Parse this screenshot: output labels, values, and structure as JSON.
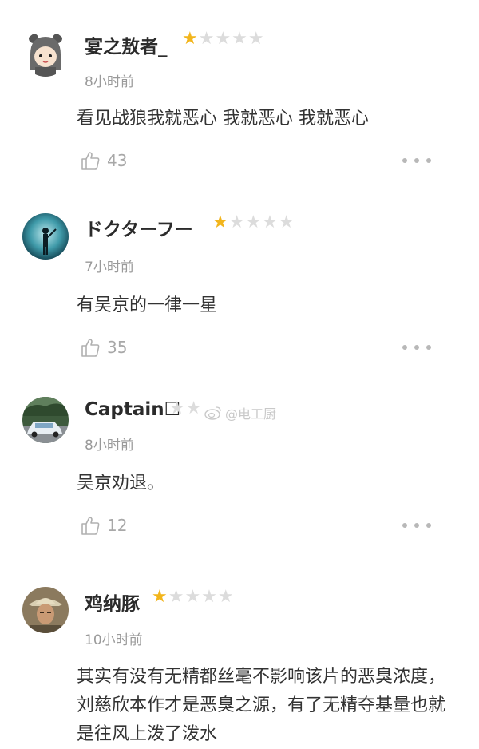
{
  "colors": {
    "star_on": "#f2b51c",
    "star_off": "#dcdcdc",
    "meta": "#9a9a9a",
    "text": "#333333"
  },
  "reviews": [
    {
      "username": "宴之敖者_",
      "rating": 1,
      "max_rating": 5,
      "time": "8小时前",
      "content": "看见战狼我就恶心 我就恶心 我就恶心",
      "likes": "43",
      "avatar_icon": "cartoon-bear-hood-avatar"
    },
    {
      "username": "ドクターフー",
      "rating": 1,
      "max_rating": 5,
      "time": "7小时前",
      "content": "有吴京的一律一星",
      "likes": "35",
      "avatar_icon": "silhouette-teal-avatar"
    },
    {
      "username": "Captain☐",
      "rating": 0,
      "max_rating": 5,
      "time": "8小时前",
      "content": "吴京劝退。",
      "likes": "12",
      "avatar_icon": "car-photo-avatar"
    },
    {
      "username": "鸡纳豚",
      "rating": 1,
      "max_rating": 5,
      "time": "10小时前",
      "content": "其实有没有无精都丝毫不影响该片的恶臭浓度，刘慈欣本作才是恶臭之源，有了无精夺基量也就是往风上泼了泼水",
      "likes": "",
      "avatar_icon": "man-safari-hat-avatar"
    }
  ],
  "watermark": {
    "text": "@电工厨",
    "icon": "weibo-icon"
  }
}
